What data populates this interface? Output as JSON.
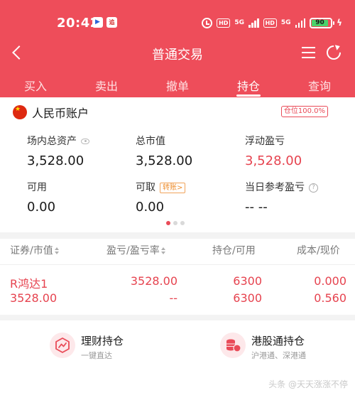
{
  "status_bar": {
    "time": "20:42",
    "app_icons": [
      "▶",
      "追"
    ],
    "hd1": "HD",
    "net1": "5G",
    "hd2": "HD",
    "net2": "5G",
    "battery": "90"
  },
  "nav": {
    "title": "普通交易"
  },
  "tabs": [
    {
      "label": "买入"
    },
    {
      "label": "卖出"
    },
    {
      "label": "撤单"
    },
    {
      "label": "持仓"
    },
    {
      "label": "查询"
    }
  ],
  "account": {
    "title": "人民币账户",
    "position_badge": "仓位100.0%",
    "metrics": {
      "total_assets": {
        "label": "场内总资产",
        "value": "3,528.00"
      },
      "market_value": {
        "label": "总市值",
        "value": "3,528.00"
      },
      "floating_pl": {
        "label": "浮动盈亏",
        "value": "3,528.00"
      },
      "available": {
        "label": "可用",
        "value": "0.00"
      },
      "withdrawable": {
        "label": "可取",
        "value": "0.00",
        "transfer_label": "转账>"
      },
      "daily_ref_pl": {
        "label": "当日参考盈亏",
        "value": "-- --"
      }
    }
  },
  "holdings": {
    "headers": [
      "证券/市值",
      "盈亏/盈亏率",
      "持仓/可用",
      "成本/现价"
    ],
    "rows": [
      {
        "name": "R鸿达1",
        "market_value": "3528.00",
        "pl": "3528.00",
        "pl_rate": "--",
        "position": "6300",
        "available": "6300",
        "cost": "0.000",
        "price": "0.560"
      }
    ]
  },
  "links": [
    {
      "title": "理财持仓",
      "subtitle": "一键直达"
    },
    {
      "title": "港股通持仓",
      "subtitle": "沪港通、深港通"
    }
  ],
  "watermark": "头条 @天天涨涨不停",
  "colors": {
    "brand_red": "#ee4d5a",
    "profit_red": "#e6434f",
    "transfer_orange": "#ee8e2e"
  }
}
